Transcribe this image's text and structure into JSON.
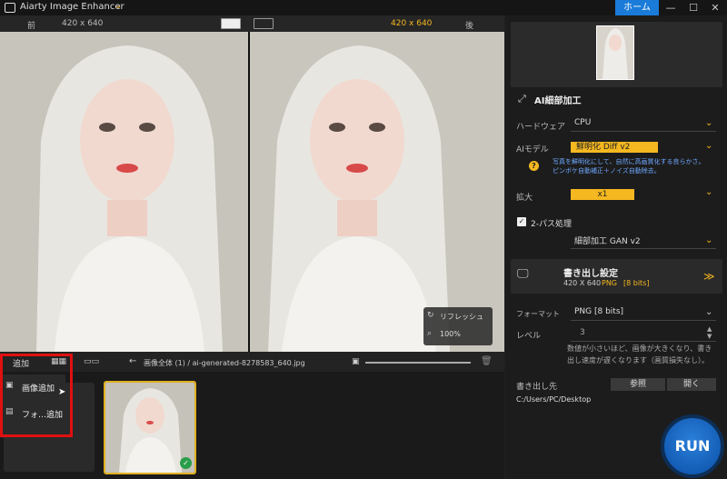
{
  "titlebar": {
    "app_title": "Aiarty Image Enhancer",
    "home": "ホーム",
    "minimize": "—",
    "maximize": "☐",
    "close": "✕"
  },
  "viewbar": {
    "before": "前",
    "left_size": "420 x 640",
    "right_size": "420 x 640",
    "after": "後"
  },
  "preview": {
    "refresh": "リフレッシュ",
    "zoom": "100%"
  },
  "bottombar": {
    "add": "追加",
    "breadcrumb": "画像全体 (1)  /  ai-generated-8278583_640.jpg"
  },
  "popup": {
    "add_image": "画像追加",
    "add_folder": "フォ…追加"
  },
  "right": {
    "section_title": "AI細部加工",
    "hardware_label": "ハードウェア",
    "hardware_value": "CPU",
    "model_label": "AIモデル",
    "model_value": "鮮明化 Diff v2",
    "model_note_1": "写真を鮮明化にして、自然に高画質化する良らかさ。",
    "model_note_2": "ピンボケ自動補正＋ノイズ自動除去。",
    "scale_label": "拡大",
    "scale_value": "x1",
    "twopass_label": "2-パス処理",
    "twopass_value": "細部加工 GAN v2",
    "export_title": "書き出し設定",
    "export_info_size": "420 X 640",
    "export_info_fmt": "PNG",
    "export_info_bits": "[8 bits]",
    "format_label": "フォーマット",
    "format_value": "PNG   [8 bits]",
    "level_label": "レベル",
    "level_value": "3",
    "level_note_1": "数値が小さいほど、画像が大きくなり、書き",
    "level_note_2": "出し速度が遅くなります（画質損失なし）。",
    "dest_label": "書き出し先",
    "browse": "参照",
    "open": "開く",
    "path": "C:/Users/PC/Desktop",
    "run": "RUN"
  },
  "colors": {
    "accent": "#f5b820",
    "home": "#1a7bd8",
    "highlight": "#e01010",
    "run": "#0a4fa8"
  }
}
